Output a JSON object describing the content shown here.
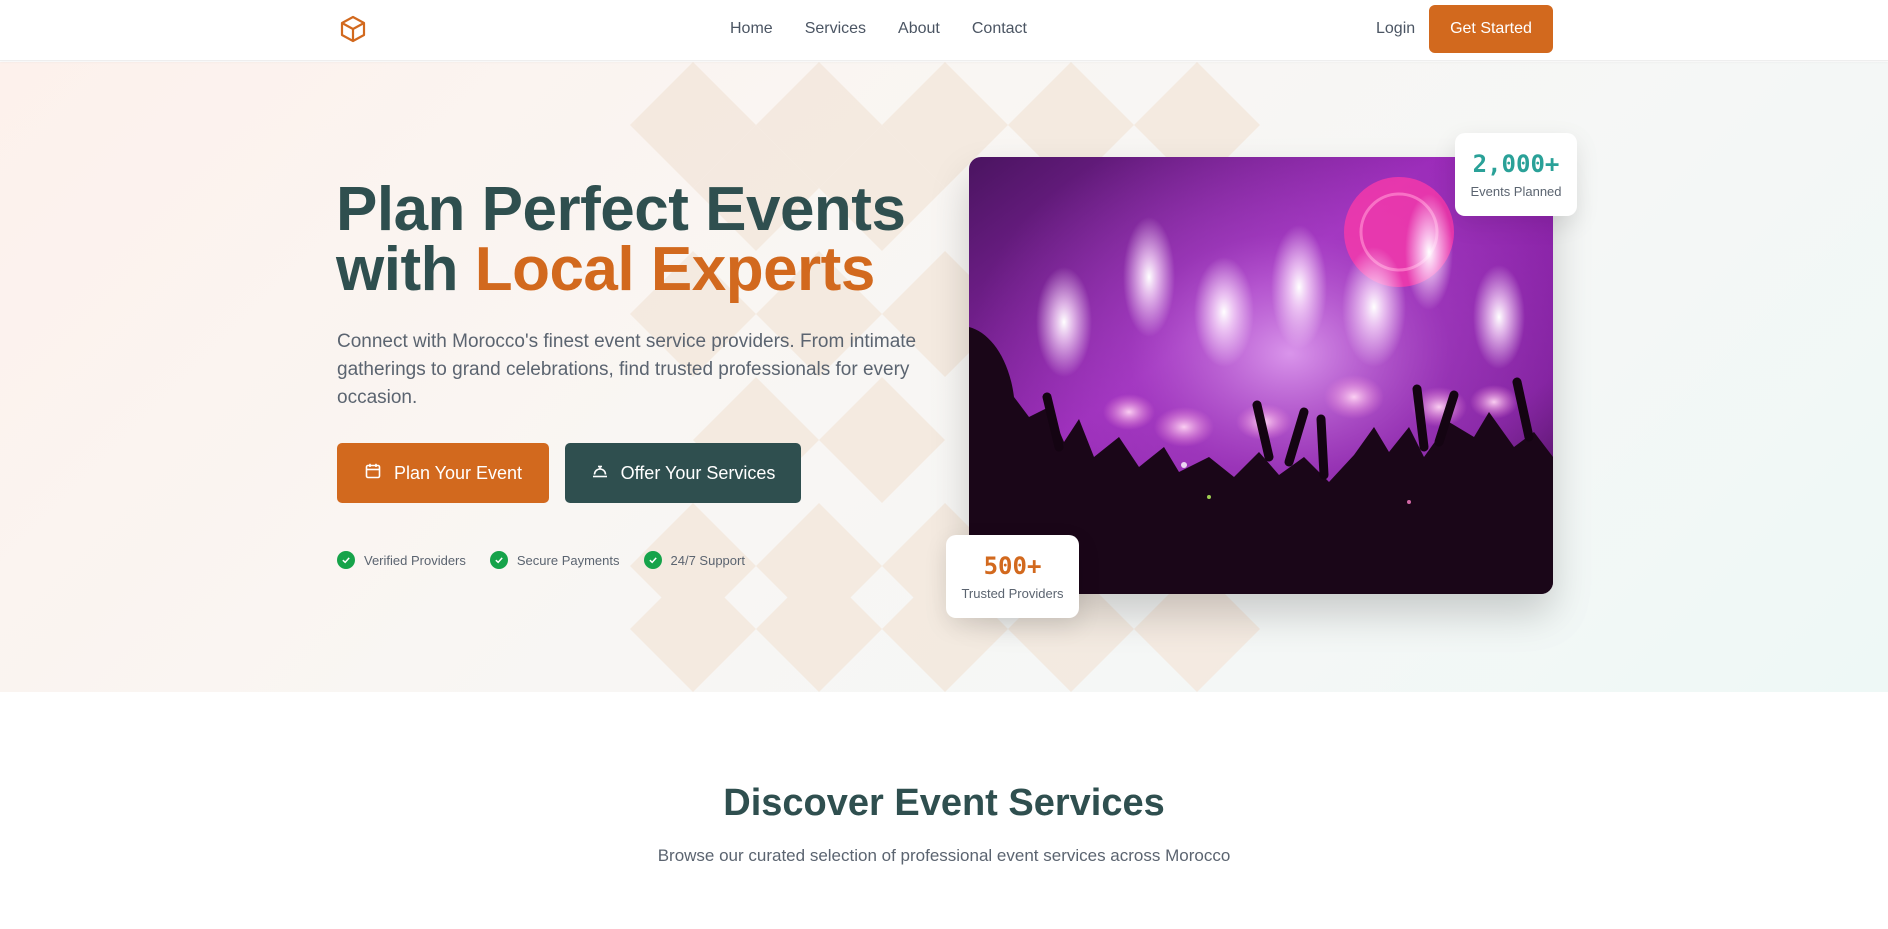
{
  "nav": {
    "links": [
      "Home",
      "Services",
      "About",
      "Contact"
    ],
    "login": "Login",
    "cta": "Get Started"
  },
  "hero": {
    "title_line1": "Plan Perfect Events",
    "title_with": "with ",
    "title_accent": "Local Experts",
    "description": "Connect with Morocco's finest event service providers. From intimate gatherings to grand celebrations, find trusted professionals for every occasion.",
    "btn_plan": "Plan Your Event",
    "btn_offer": "Offer Your Services",
    "features": [
      "Verified Providers",
      "Secure Payments",
      "24/7 Support"
    ]
  },
  "stats": {
    "events_value": "2,000+",
    "events_label": "Events Planned",
    "providers_value": "500+",
    "providers_label": "Trusted Providers"
  },
  "section": {
    "title": "Discover Event Services",
    "subtitle": "Browse our curated selection of professional event services across Morocco"
  },
  "icons": {
    "logo": "cube-icon",
    "plan": "calendar-icon",
    "offer": "service-bell-icon",
    "feature": "check-circle-icon"
  },
  "colors": {
    "primary": "#d2691e",
    "secondary": "#2f4f4f",
    "teal": "#2aa198",
    "success": "#16a34a"
  }
}
